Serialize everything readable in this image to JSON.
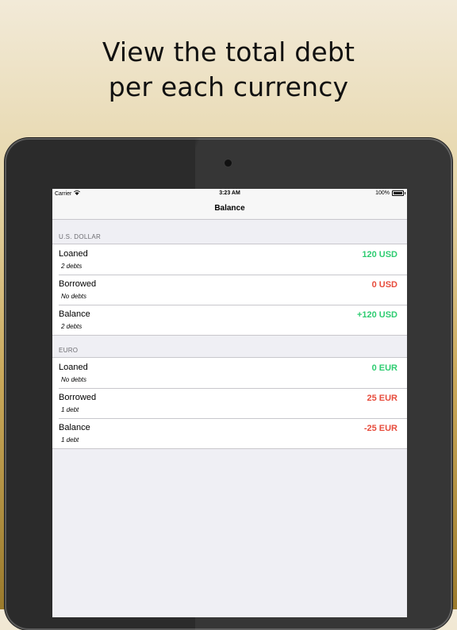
{
  "headline": {
    "line1": "View the total debt",
    "line2": "per each currency"
  },
  "status_bar": {
    "carrier": "Carrier",
    "time": "3:23 AM",
    "battery": "100%"
  },
  "nav": {
    "title": "Balance"
  },
  "sections": [
    {
      "header": "U.S. DOLLAR",
      "rows": [
        {
          "title": "Loaned",
          "subtitle": "2 debts",
          "value": "120 USD",
          "tone": "positive"
        },
        {
          "title": "Borrowed",
          "subtitle": "No debts",
          "value": "0 USD",
          "tone": "negative"
        },
        {
          "title": "Balance",
          "subtitle": "2 debts",
          "value": "+120 USD",
          "tone": "positive"
        }
      ]
    },
    {
      "header": "EURO",
      "rows": [
        {
          "title": "Loaned",
          "subtitle": "No debts",
          "value": "0 EUR",
          "tone": "positive"
        },
        {
          "title": "Borrowed",
          "subtitle": "1 debt",
          "value": "25 EUR",
          "tone": "negative"
        },
        {
          "title": "Balance",
          "subtitle": "1 debt",
          "value": "-25 EUR",
          "tone": "negative"
        }
      ]
    }
  ],
  "colors": {
    "positive": "#2ecc71",
    "negative": "#e74c3c"
  }
}
